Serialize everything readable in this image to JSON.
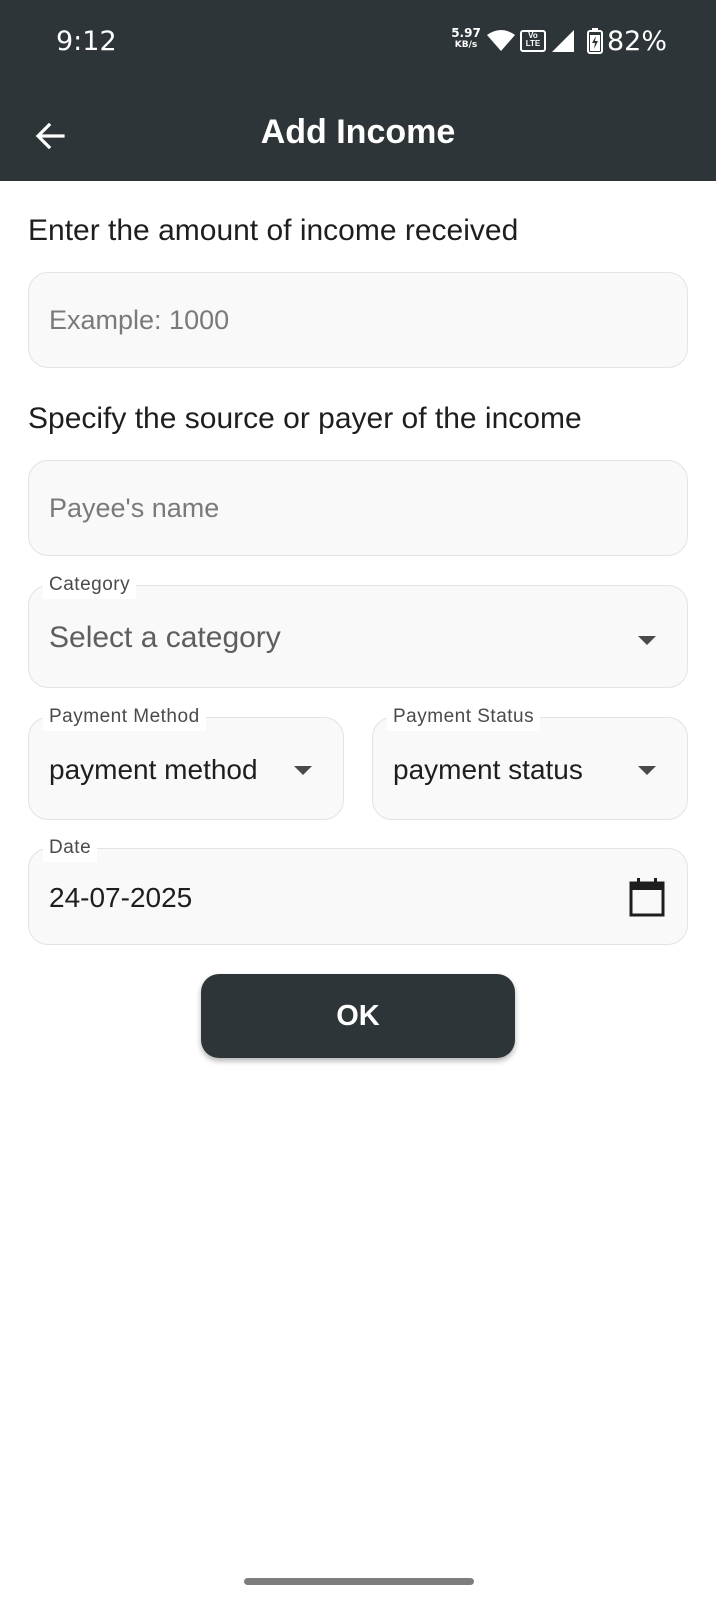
{
  "status_bar": {
    "time": "9:12",
    "net_speed_value": "5.97",
    "net_speed_unit": "KB/s",
    "volte_top": "Vo",
    "volte_bottom": "LTE",
    "battery_percent": "82%",
    "icons": [
      "wifi-icon",
      "volte-icon",
      "signal-icon",
      "battery-charging-icon"
    ]
  },
  "app_bar": {
    "title": "Add Income",
    "back_icon": "arrow-left-icon"
  },
  "form": {
    "amount_label": "Enter the amount of income received",
    "amount_placeholder": "Example: 1000",
    "amount_value": "",
    "source_label": "Specify the source or payer of the income",
    "payee_placeholder": "Payee's name",
    "payee_value": "",
    "category": {
      "label": "Category",
      "value": "Select a category"
    },
    "payment_method": {
      "label": "Payment Method",
      "value": "payment method"
    },
    "payment_status": {
      "label": "Payment Status",
      "value": "payment status"
    },
    "date": {
      "label": "Date",
      "value": "24-07-2025",
      "icon": "calendar-icon"
    },
    "ok_label": "OK"
  },
  "colors": {
    "app_bar": "#2d3538",
    "field_background": "#f9f9f9",
    "field_border": "#e3e3e3",
    "button": "#2d3538"
  }
}
